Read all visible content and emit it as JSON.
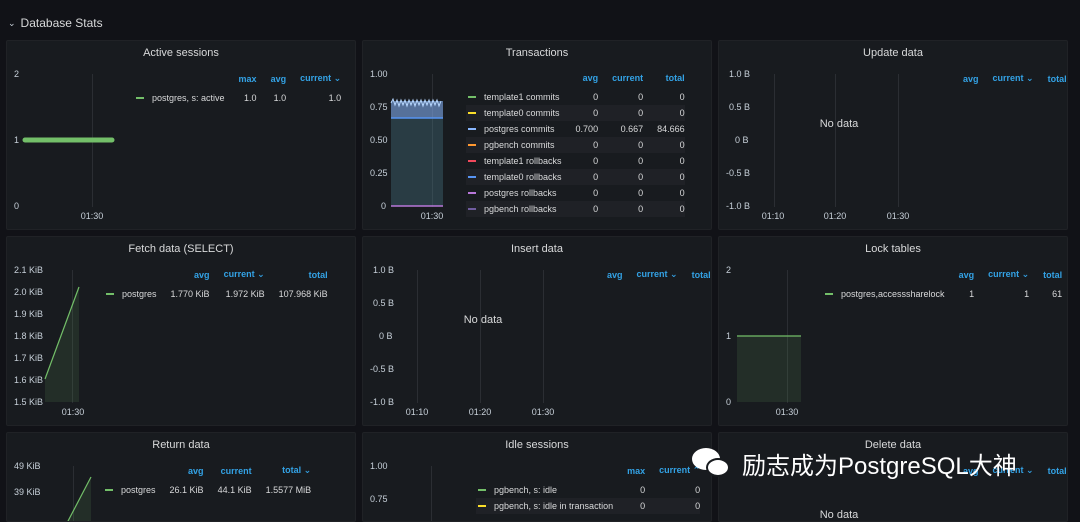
{
  "section": {
    "title": "Database Stats",
    "chevron": "⌄"
  },
  "panels": {
    "active_sessions": {
      "title": "Active sessions",
      "yticks": [
        "2",
        "1",
        "0"
      ],
      "xticks": [
        "01:30"
      ],
      "legend": {
        "headers": [
          "max",
          "avg",
          "current ⌄"
        ],
        "rows": [
          {
            "name": "postgres, s: active",
            "color": "#73bf69",
            "values": [
              "1.0",
              "1.0",
              "1.0"
            ]
          }
        ]
      }
    },
    "transactions": {
      "title": "Transactions",
      "yticks": [
        "1.00",
        "0.75",
        "0.50",
        "0.25",
        "0"
      ],
      "xticks": [
        "01:30"
      ],
      "legend": {
        "headers": [
          "avg",
          "current",
          "total"
        ],
        "rows": [
          {
            "name": "template1 commits",
            "color": "#73bf69",
            "values": [
              "0",
              "0",
              "0"
            ]
          },
          {
            "name": "template0 commits",
            "color": "#fade2a",
            "values": [
              "0",
              "0",
              "0"
            ]
          },
          {
            "name": "postgres commits",
            "color": "#5794f2",
            "values": [
              "0.700",
              "0.667",
              "84.666"
            ]
          },
          {
            "name": "pgbench commits",
            "color": "#ff9830",
            "values": [
              "0",
              "0",
              "0"
            ]
          },
          {
            "name": "template1 rollbacks",
            "color": "#f2495c",
            "values": [
              "0",
              "0",
              "0"
            ]
          },
          {
            "name": "template0 rollbacks",
            "color": "#5794f2",
            "values": [
              "0",
              "0",
              "0"
            ]
          },
          {
            "name": "postgres rollbacks",
            "color": "#b877d9",
            "values": [
              "0",
              "0",
              "0"
            ]
          },
          {
            "name": "pgbench rollbacks",
            "color": "#705da0",
            "values": [
              "0",
              "0",
              "0"
            ]
          }
        ]
      }
    },
    "update_data": {
      "title": "Update data",
      "yticks": [
        "1.0 B",
        "0.5 B",
        "0 B",
        "-0.5 B",
        "-1.0 B"
      ],
      "xticks": [
        "01:10",
        "01:20",
        "01:30"
      ],
      "nodata": "No data",
      "legend": {
        "headers": [
          "avg",
          "current ⌄",
          "total"
        ],
        "rows": []
      }
    },
    "fetch_data": {
      "title": "Fetch data (SELECT)",
      "yticks": [
        "2.1 KiB",
        "2.0 KiB",
        "1.9 KiB",
        "1.8 KiB",
        "1.7 KiB",
        "1.6 KiB",
        "1.5 KiB"
      ],
      "xticks": [
        "01:30"
      ],
      "legend": {
        "headers": [
          "avg",
          "current ⌄",
          "total"
        ],
        "rows": [
          {
            "name": "postgres",
            "color": "#73bf69",
            "values": [
              "1.770 KiB",
              "1.972 KiB",
              "107.968 KiB"
            ]
          }
        ]
      }
    },
    "insert_data": {
      "title": "Insert data",
      "yticks": [
        "1.0 B",
        "0.5 B",
        "0 B",
        "-0.5 B",
        "-1.0 B"
      ],
      "xticks": [
        "01:10",
        "01:20",
        "01:30"
      ],
      "nodata": "No data",
      "legend": {
        "headers": [
          "avg",
          "current ⌄",
          "total"
        ],
        "rows": []
      }
    },
    "lock_tables": {
      "title": "Lock tables",
      "yticks": [
        "2",
        "1",
        "0"
      ],
      "xticks": [
        "01:30"
      ],
      "legend": {
        "headers": [
          "avg",
          "current ⌄",
          "total"
        ],
        "rows": [
          {
            "name": "postgres,accesssharelock",
            "color": "#73bf69",
            "values": [
              "1",
              "1",
              "61"
            ]
          }
        ]
      }
    },
    "return_data": {
      "title": "Return data",
      "yticks": [
        "49 KiB",
        "39 KiB"
      ],
      "legend": {
        "headers": [
          "avg",
          "current",
          "total ⌄"
        ],
        "rows": [
          {
            "name": "postgres",
            "color": "#73bf69",
            "values": [
              "26.1 KiB",
              "44.1 KiB",
              "1.5577 MiB"
            ]
          }
        ]
      }
    },
    "idle_sessions": {
      "title": "Idle sessions",
      "yticks": [
        "1.00",
        "0.75"
      ],
      "legend": {
        "headers": [
          "max",
          "current ⌃"
        ],
        "rows": [
          {
            "name": "pgbench, s: idle",
            "color": "#73bf69",
            "values": [
              "0",
              "0"
            ]
          },
          {
            "name": "pgbench, s: idle in transaction",
            "color": "#fade2a",
            "values": [
              "0",
              "0"
            ]
          }
        ]
      }
    },
    "delete_data": {
      "title": "Delete data",
      "nodata": "No data",
      "legend": {
        "headers": [
          "avg",
          "current ⌄",
          "total"
        ],
        "rows": []
      }
    }
  },
  "watermark": {
    "text": "励志成为PostgreSQL大神"
  },
  "chart_data": [
    {
      "type": "line",
      "title": "Active sessions",
      "x": [
        "01:30"
      ],
      "series": [
        {
          "name": "postgres, s: active",
          "values": [
            1.0
          ]
        }
      ],
      "ylim": [
        0,
        2
      ]
    },
    {
      "type": "area",
      "title": "Transactions",
      "series": [
        {
          "name": "postgres commits",
          "values": [
            0.7,
            0.667
          ]
        }
      ],
      "ylim": [
        0,
        1.0
      ]
    },
    {
      "type": "line",
      "title": "Fetch data (SELECT)",
      "ylabel": "",
      "series": [
        {
          "name": "postgres",
          "values": [
            1.6,
            2.02
          ]
        }
      ],
      "ylim": [
        1.5,
        2.1
      ]
    },
    {
      "type": "area",
      "title": "Lock tables",
      "series": [
        {
          "name": "postgres,accesssharelock",
          "values": [
            1,
            1
          ]
        }
      ],
      "ylim": [
        0,
        2
      ]
    },
    {
      "type": "line",
      "title": "Return data",
      "series": [
        {
          "name": "postgres",
          "values": [
            26.1,
            44.1
          ]
        }
      ]
    }
  ]
}
